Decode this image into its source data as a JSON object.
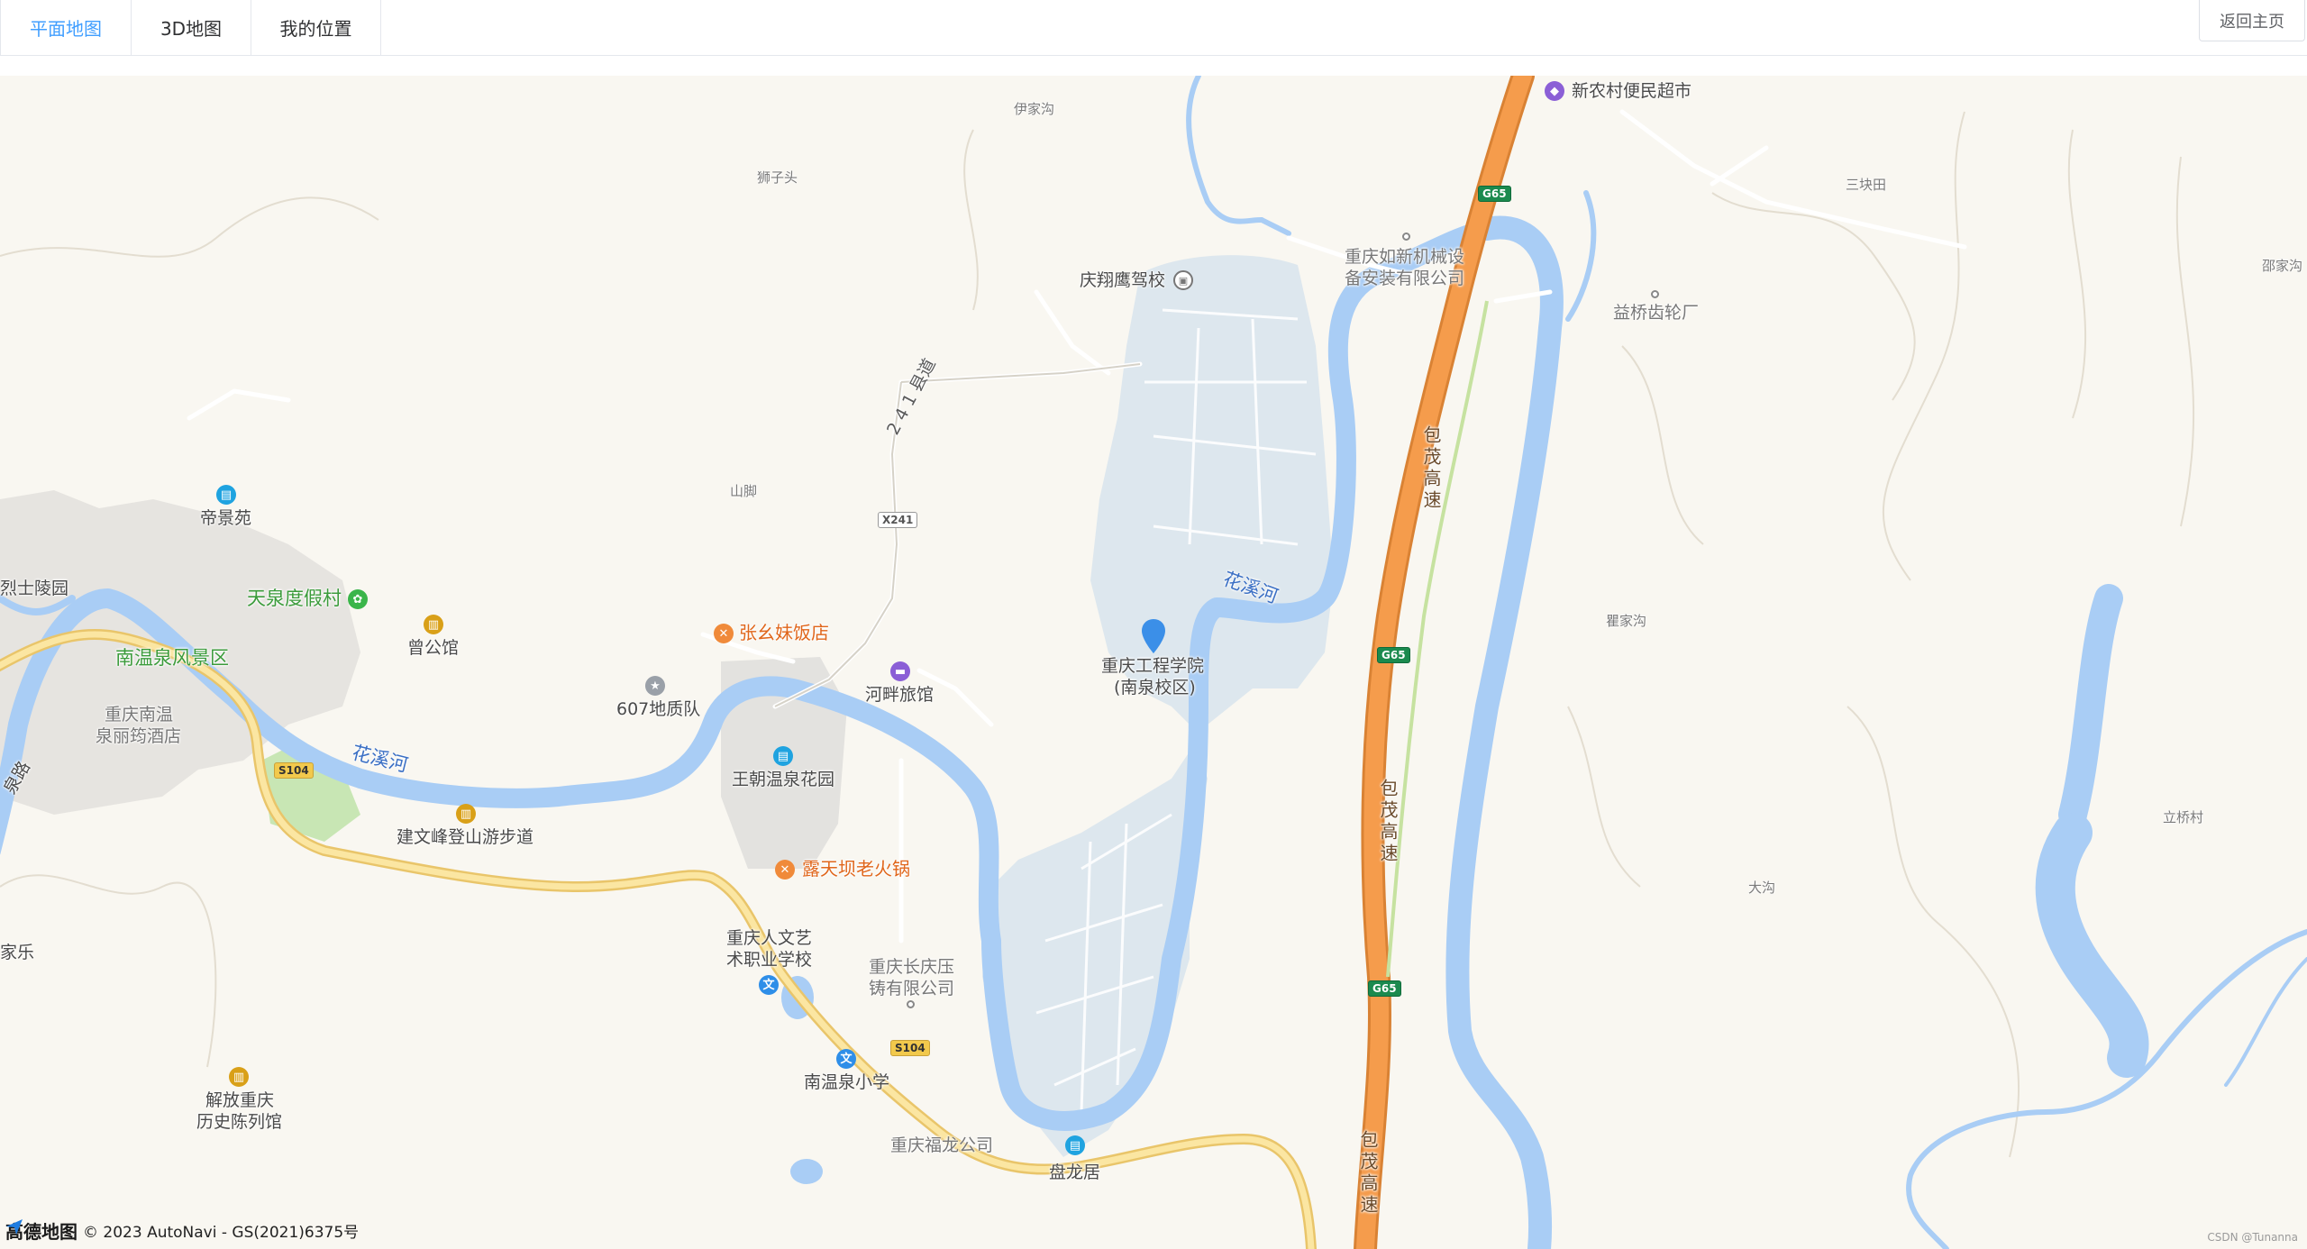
{
  "tabs": [
    {
      "label": "平面地图",
      "active": true
    },
    {
      "label": "3D地图",
      "active": false
    },
    {
      "label": "我的位置",
      "active": false
    }
  ],
  "home_button": "返回主页",
  "marker": {
    "label_line1": "重庆工程学院",
    "label_line2": "(南泉校区)"
  },
  "places": {
    "yijiagou": "伊家沟",
    "shizitou": "狮子头",
    "xinnongcun": "新农村便民超市",
    "sankuaitian": "三块田",
    "shaojiagou": "邵家沟",
    "rxjx_line1": "重庆如新机械设",
    "rxjx_line2": "备安装有限公司",
    "yiqiao": "益桥齿轮厂",
    "qingxiang": "庆翔鹰驾校",
    "county_road": "2 4 1 县道",
    "shanjiao": "山脚",
    "dijingyuan": "帝景苑",
    "lingyuan": "烈士陵园",
    "tianquan": "天泉度假村",
    "zenggongguan": "曾公馆",
    "zhangyaomei": "张幺妹饭店",
    "nanwenquan_scenic": "南温泉风景区",
    "dizhidui": "607地质队",
    "hepan": "河畔旅馆",
    "nwq_hotel_line1": "重庆南温",
    "nwq_hotel_line2": "泉丽筠酒店",
    "wangchao": "王朝温泉花园",
    "river_label": "花溪河",
    "jianwenfeng": "建文峰登山游步道",
    "lutianba": "露天坝老火锅",
    "renwen_line1": "重庆人文艺",
    "renwen_line2": "术职业学校",
    "changqing_line1": "重庆长庆压",
    "changqing_line2": "铸有限公司",
    "nwq_school": "南温泉小学",
    "fulong": "重庆福龙公司",
    "panlongju": "盘龙居",
    "jiefang_line1": "解放重庆",
    "jiefang_line2": "历史陈列馆",
    "jiale": "家乐",
    "quanlu": "泉路",
    "qujiagou": "瞿家沟",
    "liqiaocun": "立桥村",
    "dagou": "大沟",
    "baomao": "包茂高速"
  },
  "road_shields": {
    "g65": "G65",
    "s104": "S104",
    "x241": "X241"
  },
  "icons": {
    "school": "文",
    "dining": "fork-knife-icon",
    "hotel": "bed-icon",
    "shopping": "cart-icon",
    "scenic": "tree-icon",
    "museum": "museum-icon",
    "residential": "building-icon",
    "pin": "location-pin-icon"
  },
  "footer": {
    "brand": "高德地图",
    "copyright": "© 2023 AutoNavi - GS(2021)6375号",
    "watermark": "CSDN @Tunanna"
  },
  "colors": {
    "active_tab": "#409eff",
    "land": "#f9f7f1",
    "water": "#a9cdf5",
    "highway": "#f59c4c",
    "campus": "#dde7ee",
    "marker": "#3b8fe8"
  }
}
